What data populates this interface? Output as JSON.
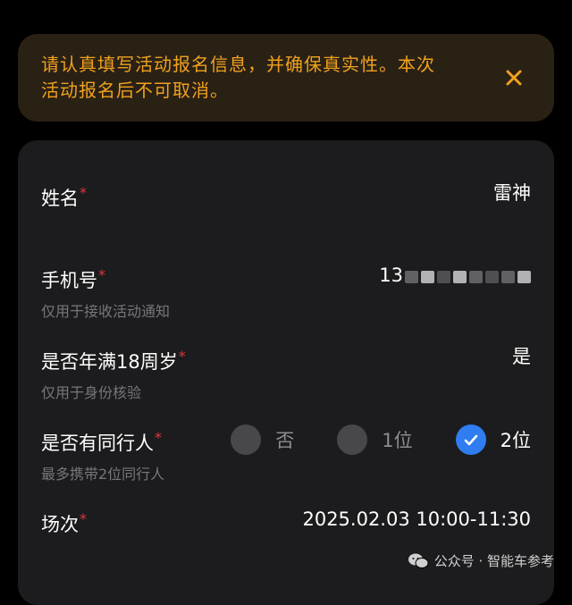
{
  "notice": {
    "line1": "请认真填写活动报名信息，并确保真实性。本次",
    "line2": "活动报名后不可取消。",
    "close_icon": "close-icon",
    "color": "#f0a11e"
  },
  "form": {
    "name": {
      "label": "姓名",
      "required_mark": "*",
      "value": "雷神"
    },
    "phone": {
      "label": "手机号",
      "required_mark": "*",
      "hint": "仅用于接收活动通知",
      "value_prefix": "13"
    },
    "adult": {
      "label": "是否年满18周岁",
      "required_mark": "*",
      "hint": "仅用于身份核验",
      "value": "是"
    },
    "companion": {
      "label": "是否有同行人",
      "required_mark": "*",
      "hint": "最多携带2位同行人",
      "options": [
        {
          "label": "否",
          "selected": false
        },
        {
          "label": "1位",
          "selected": false
        },
        {
          "label": "2位",
          "selected": true
        }
      ]
    },
    "session": {
      "label": "场次",
      "required_mark": "*",
      "value": "2025.02.03 10:00-11:30"
    }
  },
  "watermark": {
    "text": "公众号 · 智能车参考",
    "icon": "wechat-icon"
  },
  "colors": {
    "accent": "#2f7df0",
    "required": "#e0363b",
    "card": "#1c1c1e"
  }
}
